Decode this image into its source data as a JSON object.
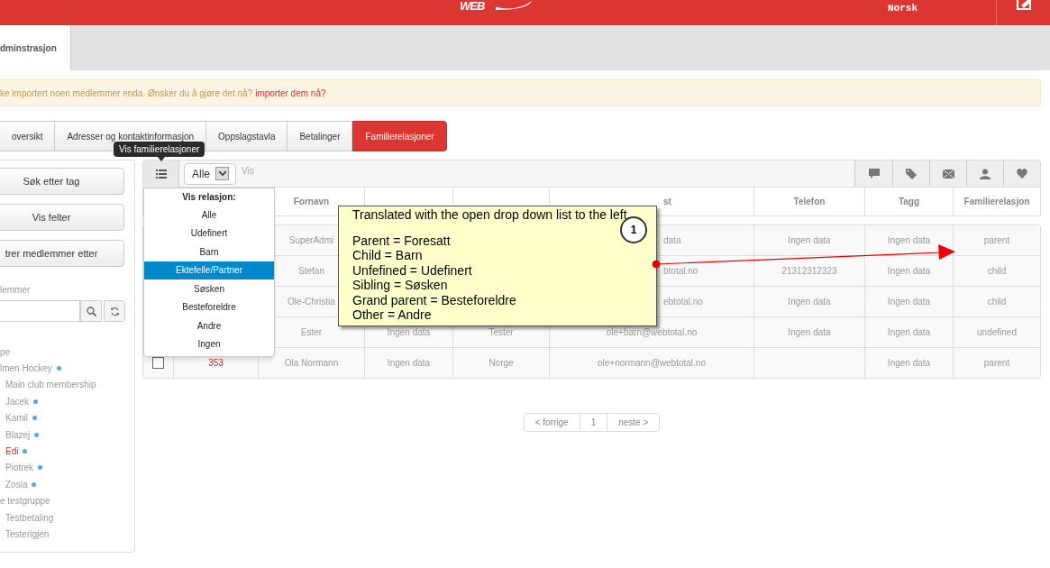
{
  "header": {
    "logo": "WEB",
    "language": "Norsk"
  },
  "page_tab": {
    "label": "dminstrasjon"
  },
  "alert": {
    "text": "ke importert noen medlemmer enda. Ønsker du å gjøre det nå?",
    "link": "importer dem nå?"
  },
  "tabs": [
    {
      "label": "oversikt",
      "selected": false
    },
    {
      "label": "Adresser og kontaktinformasjon",
      "selected": false
    },
    {
      "label": "Oppslagstavla",
      "selected": false
    },
    {
      "label": "Betalinger",
      "selected": false
    },
    {
      "label": "Familierelasjoner",
      "selected": true
    }
  ],
  "tooltip": "Vis familierelasjoner",
  "sidebar": {
    "buttons": [
      "Søk etter tag",
      "Vis felter",
      "trer medlemmer etter"
    ],
    "search_label": "lemmer",
    "tree": [
      {
        "label": "pe",
        "marked": false,
        "selected": false
      },
      {
        "label": "lmen Hockey",
        "marked": true,
        "selected": false,
        "children": [
          {
            "label": "Main club membership",
            "marked": false,
            "selected": false
          },
          {
            "label": "Jacek",
            "marked": true,
            "selected": false
          },
          {
            "label": "Kamil",
            "marked": true,
            "selected": false
          },
          {
            "label": "Blazej",
            "marked": true,
            "selected": false
          },
          {
            "label": "Edi",
            "marked": true,
            "selected": true
          },
          {
            "label": "Piotrek",
            "marked": true,
            "selected": false
          },
          {
            "label": "Zosia",
            "marked": true,
            "selected": false
          }
        ]
      },
      {
        "label": "e testgruppe",
        "marked": false,
        "selected": false,
        "children": [
          {
            "label": "Testbetaling",
            "marked": false,
            "selected": false
          },
          {
            "label": "Testerigjen",
            "marked": false,
            "selected": false
          }
        ]
      }
    ]
  },
  "toolbar": {
    "filter": "Alle",
    "filter_label": "Vis"
  },
  "dropdown": {
    "title": "Vis relasjon:",
    "items": [
      {
        "label": "Alle",
        "selected": false
      },
      {
        "label": "Udefinert",
        "selected": false
      },
      {
        "label": "Barn",
        "selected": false
      },
      {
        "label": "Ektefelle/Partner",
        "selected": true
      },
      {
        "label": "Søsken",
        "selected": false
      },
      {
        "label": "Besteforeldre",
        "selected": false
      },
      {
        "label": "Andre",
        "selected": false
      },
      {
        "label": "Ingen",
        "selected": false
      }
    ]
  },
  "table": {
    "columns": [
      null,
      null,
      "Fornavn",
      null,
      null,
      "st",
      "Telefon",
      "Tagg",
      "Familierelasjon"
    ],
    "rows": [
      {
        "cells": [
          null,
          null,
          "SuperAdmi",
          null,
          null,
          "data",
          "Ingen data",
          "Ingen data",
          "parent"
        ]
      },
      {
        "cells": [
          null,
          null,
          "Stefan",
          null,
          null,
          "btotal.no",
          "21312312323",
          "Ingen data",
          "child"
        ]
      },
      {
        "cells": [
          null,
          null,
          "Ole-Christia",
          null,
          null,
          "ebtotal.no",
          "Ingen data",
          "Ingen data",
          "child"
        ]
      },
      {
        "cells": [
          null,
          null,
          "Ester",
          "Ingen data",
          "Tester",
          "ole+barn@webtotal.no",
          "Ingen data",
          "Ingen data",
          "undefined"
        ]
      },
      {
        "checked": false,
        "cells": [
          null,
          "353",
          "Ola Normann",
          "Ingen data",
          "Norge",
          "ole+normann@webtotal.no",
          null,
          "Ingen data",
          "parent"
        ]
      }
    ]
  },
  "note": {
    "number": "1",
    "title": "Translated with the open drop down list to the left",
    "lines": [
      "Parent = Foresatt",
      "Child = Barn",
      "Unfefined = Udefinert",
      "Sibling = Søsken",
      "Grand parent = Besteforeldre",
      "Other = Andre"
    ]
  },
  "pagination": {
    "previous": "< forrige",
    "pages": [
      "1"
    ],
    "next": "neste >"
  }
}
